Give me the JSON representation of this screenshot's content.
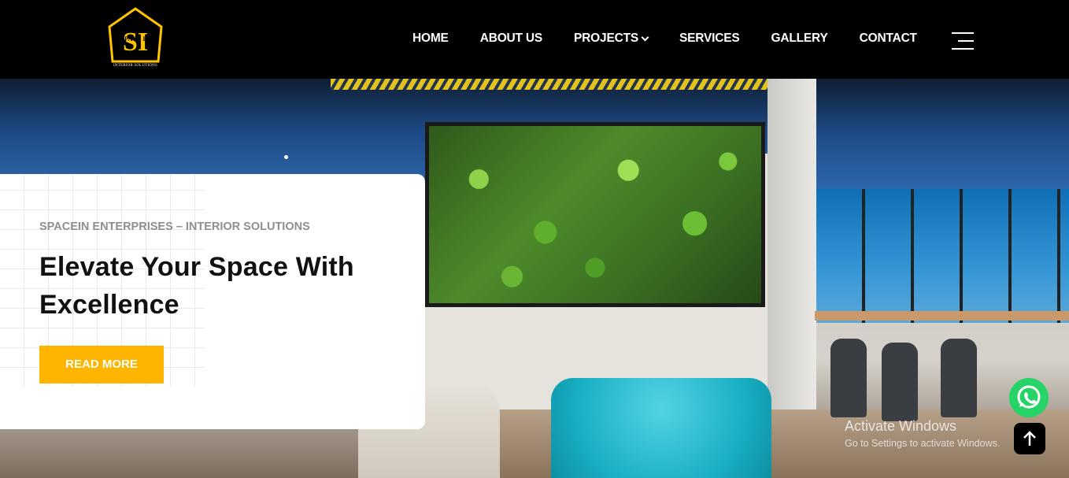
{
  "logo": {
    "letters": "SI",
    "brand": "SPACE IN",
    "tagline": "INTERIOR SOLUTIONS",
    "color": "#ffc300"
  },
  "nav": {
    "items": [
      {
        "label": "HOME"
      },
      {
        "label": "ABOUT US"
      },
      {
        "label": "PROJECTS",
        "icon": "chevron-down-icon"
      },
      {
        "label": "SERVICES"
      },
      {
        "label": "GALLERY"
      },
      {
        "label": "CONTACT"
      }
    ],
    "menu_icon": "hamburger-icon"
  },
  "hero": {
    "eyebrow": "SPACEIN ENTERPRISES – INTERIOR SOLUTIONS",
    "headline": "Elevate Your Space With Excellence",
    "button_label": "READ MORE",
    "accent": "#ffb400"
  },
  "floating": {
    "whatsapp_icon": "whatsapp-icon",
    "scroll_top_icon": "arrow-up-icon",
    "whatsapp_color": "#25d366"
  },
  "watermark": {
    "title": "Activate Windows",
    "subtitle": "Go to Settings to activate Windows."
  }
}
